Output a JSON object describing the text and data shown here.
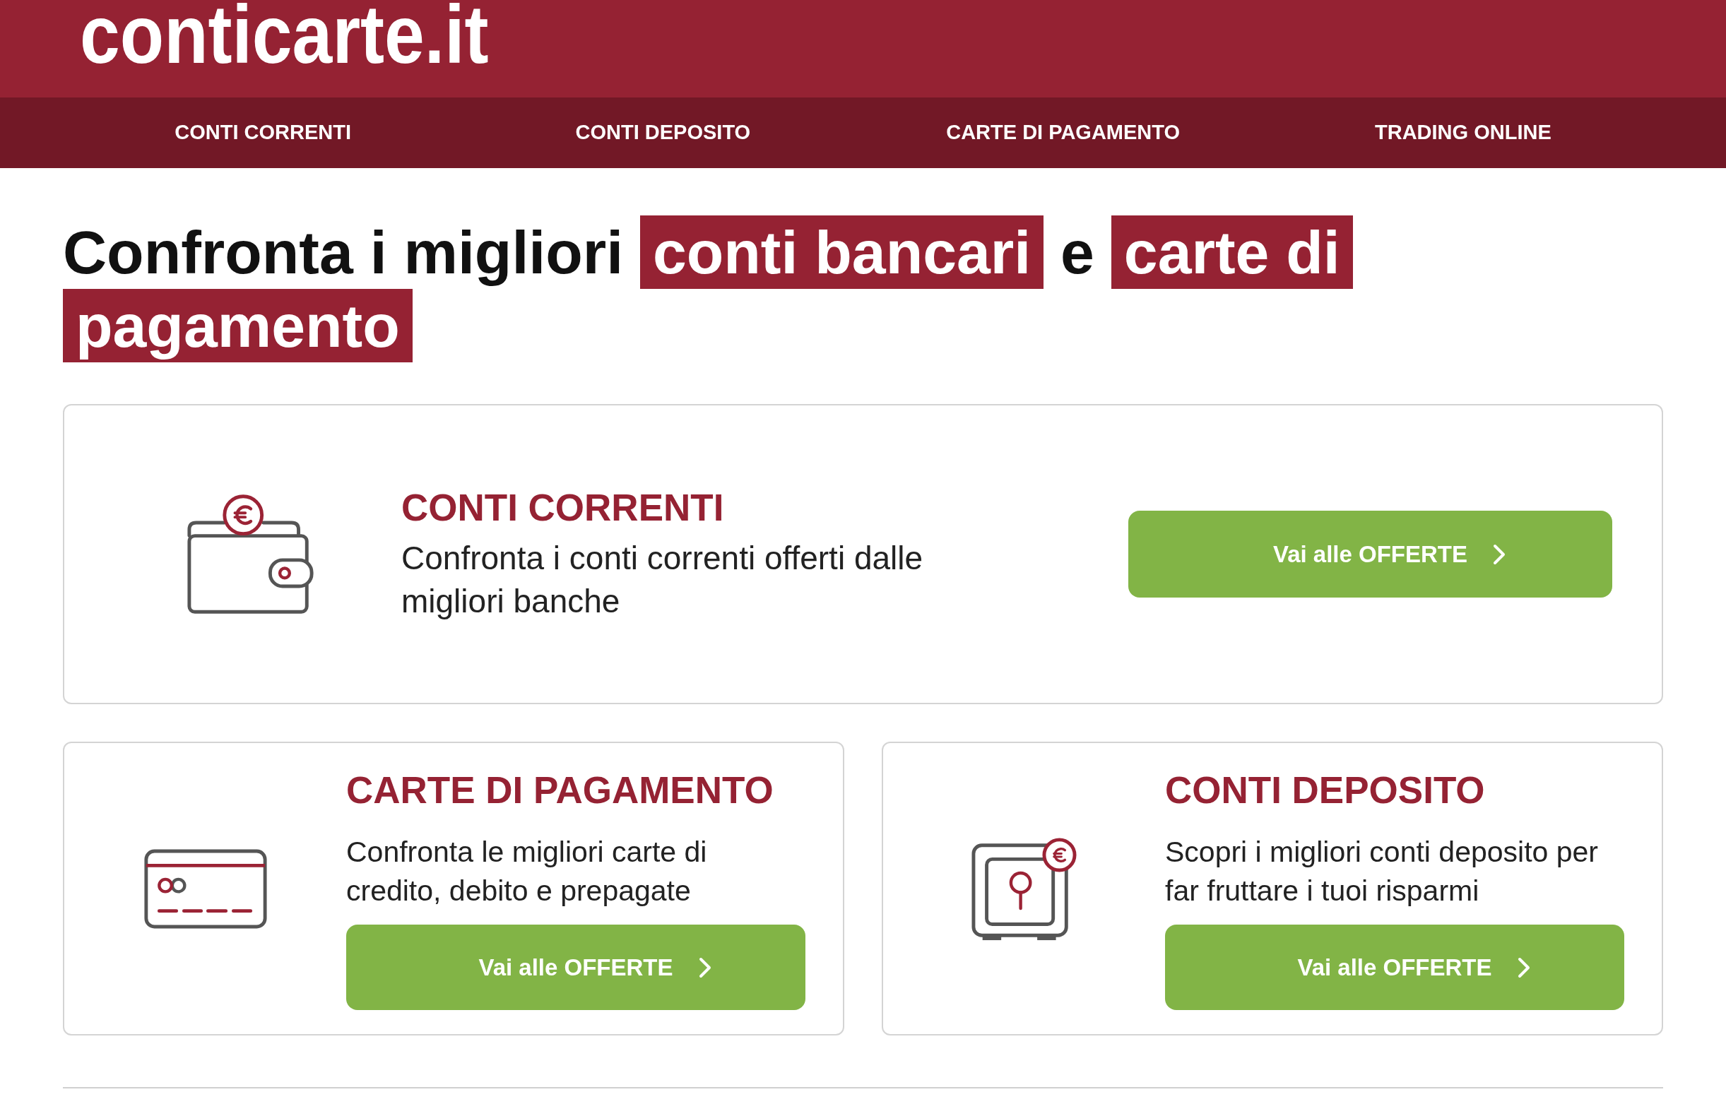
{
  "header": {
    "logo": "conticarte.it"
  },
  "nav": {
    "items": [
      "CONTI CORRENTI",
      "CONTI DEPOSITO",
      "CARTE DI PAGAMENTO",
      "TRADING ONLINE"
    ]
  },
  "hero": {
    "heading": "Confronta i migliori **conti bancari** e **carte di pagamento**"
  },
  "cards": [
    {
      "kind": "wide",
      "title": "CONTI CORRENTI",
      "description": "Confronta i conti correnti offerti dalle migliori banche",
      "button": "Vai alle OFFERTE"
    },
    {
      "kind": "half",
      "title": "CARTE DI PAGAMENTO",
      "description": "Confronta le migliori carte di credito, debito e prepagate",
      "button": "Vai alle OFFERTE"
    },
    {
      "kind": "half",
      "title": "CONTI DEPOSITO",
      "description": "Scopri i migliori conti deposito per far fruttare i tuoi risparmi",
      "button": "Vai alle OFFERTE"
    }
  ]
}
